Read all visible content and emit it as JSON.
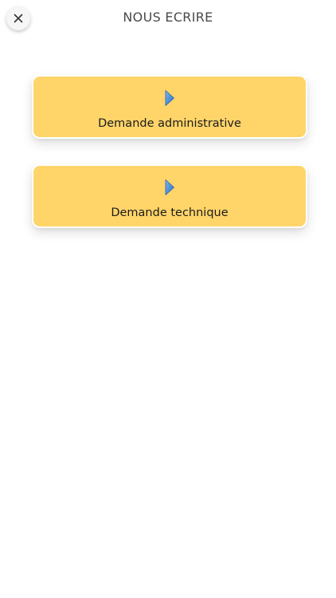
{
  "header": {
    "title": "NOUS ECRIRE",
    "close_icon": "close-icon"
  },
  "options": [
    {
      "label": "Demande administrative",
      "icon": "play-arrow-icon"
    },
    {
      "label": "Demande technique",
      "icon": "play-arrow-icon"
    }
  ],
  "colors": {
    "card_background": "#ffd469",
    "icon_blue": "#3f86d6",
    "text": "#1c1c1c",
    "title": "#4a4a4a"
  }
}
